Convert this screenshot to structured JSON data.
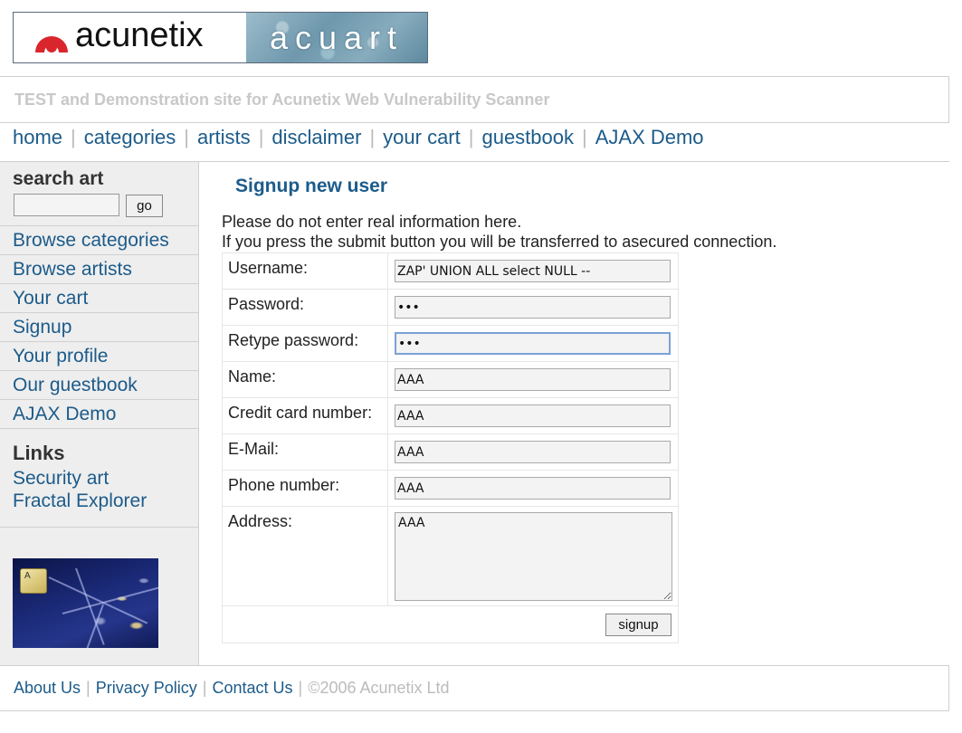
{
  "header": {
    "brand": "acunetix",
    "product": "acuart",
    "tagline": "TEST and Demonstration site for Acunetix Web Vulnerability Scanner"
  },
  "topnav": [
    "home",
    "categories",
    "artists",
    "disclaimer",
    "your cart",
    "guestbook",
    "AJAX Demo"
  ],
  "sidebar": {
    "search_title": "search art",
    "search_value": "",
    "go_label": "go",
    "menu": [
      "Browse categories",
      "Browse artists",
      "Your cart",
      "Signup",
      "Your profile",
      "Our guestbook",
      "AJAX Demo"
    ],
    "links_title": "Links",
    "links": [
      "Security art",
      "Fractal Explorer"
    ],
    "fractal_key_letter": "A"
  },
  "main": {
    "title": "Signup new user",
    "intro_line1": "Please do not enter real information here.",
    "intro_line2": "If you press the submit button you will be transferred to asecured connection.",
    "form": {
      "username_label": "Username:",
      "username_value": "ZAP' UNION ALL select NULL --",
      "password_label": "Password:",
      "password_value": "aaa",
      "retype_label": "Retype password:",
      "retype_value": "aaa",
      "name_label": "Name:",
      "name_value": "AAA",
      "cc_label": "Credit card number:",
      "cc_value": "AAA",
      "email_label": "E-Mail:",
      "email_value": "AAA",
      "phone_label": "Phone number:",
      "phone_value": "AAA",
      "address_label": "Address:",
      "address_value": "AAA",
      "submit_label": "signup"
    }
  },
  "footer": {
    "links": [
      "About Us",
      "Privacy Policy",
      "Contact Us"
    ],
    "copyright": "©2006 Acunetix Ltd"
  },
  "colors": {
    "link": "#1c5b8a",
    "brand_red": "#d9262c",
    "tagline": "#c8c8c8",
    "sidebar_bg": "#eeeeee"
  }
}
